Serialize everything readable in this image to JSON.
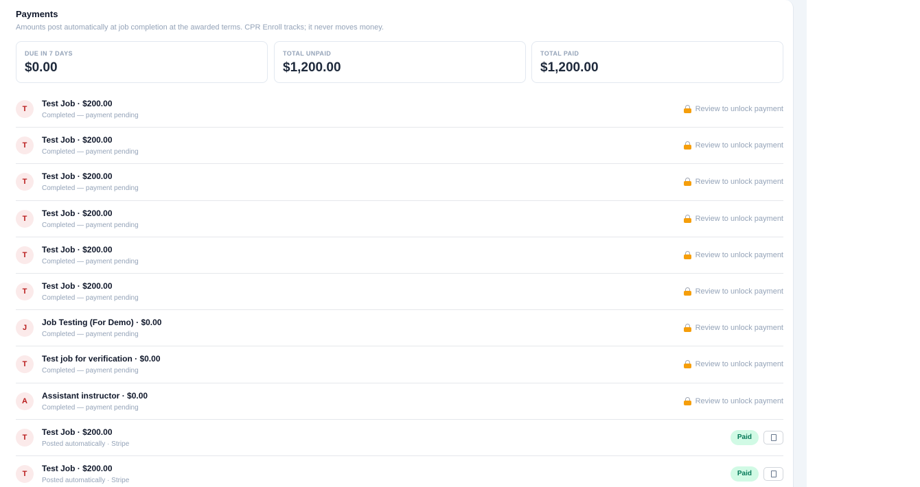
{
  "header": {
    "title": "Payments",
    "subtitle": "Amounts post automatically at job completion at the awarded terms. CPR Enroll tracks; it never moves money."
  },
  "stats": [
    {
      "label": "DUE IN 7 DAYS",
      "value": "$0.00"
    },
    {
      "label": "TOTAL UNPAID",
      "value": "$1,200.00"
    },
    {
      "label": "TOTAL PAID",
      "value": "$1,200.00"
    }
  ],
  "payments": [
    {
      "initial": "T",
      "title": "Test Job · $200.00",
      "subtitle": "Completed — payment pending",
      "action": "Review to unlock payment"
    },
    {
      "initial": "T",
      "title": "Test Job · $200.00",
      "subtitle": "Completed — payment pending",
      "action": "Review to unlock payment"
    },
    {
      "initial": "T",
      "title": "Test Job · $200.00",
      "subtitle": "Completed — payment pending",
      "action": "Review to unlock payment"
    },
    {
      "initial": "T",
      "title": "Test Job · $200.00",
      "subtitle": "Completed — payment pending",
      "action": "Review to unlock payment"
    },
    {
      "initial": "T",
      "title": "Test Job · $200.00",
      "subtitle": "Completed — payment pending",
      "action": "Review to unlock payment"
    },
    {
      "initial": "T",
      "title": "Test Job · $200.00",
      "subtitle": "Completed — payment pending",
      "action": "Review to unlock payment"
    },
    {
      "initial": "J",
      "title": "Job Testing (For Demo) · $0.00",
      "subtitle": "Completed — payment pending",
      "action": "Review to unlock payment"
    },
    {
      "initial": "T",
      "title": "Test job for verification · $0.00",
      "subtitle": "Completed — payment pending",
      "action": "Review to unlock payment"
    },
    {
      "initial": "A",
      "title": "Assistant instructor · $0.00",
      "subtitle": "Completed — payment pending",
      "action": "Review to unlock payment"
    },
    {
      "initial": "T",
      "title": "Test Job · $200.00",
      "subtitle": "Posted automatically · Stripe",
      "status": "Paid"
    },
    {
      "initial": "T",
      "title": "Test Job · $200.00",
      "subtitle": "Posted automatically · Stripe",
      "status": "Paid"
    }
  ],
  "icons": {
    "pending": "lock-icon",
    "paid": "receipt-icon"
  },
  "colors": {
    "paid_bg": "#d1fae5",
    "paid_text": "#047857",
    "avatar_bg": "#fbeaea",
    "avatar_text": "#b91c1c"
  }
}
